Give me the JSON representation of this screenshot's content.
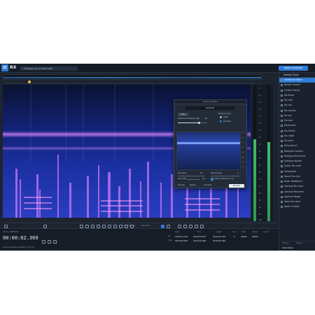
{
  "app": {
    "logo": "iZ",
    "name": "RX",
    "file_tab": "Dialogue on a beach.wav",
    "repair_assistant": "Repair Assistant",
    "time_display": "00:00:02.369",
    "instant_process": "Instant process",
    "attenuate": "Attenuate",
    "history_label": "Learned Ambience Match (175 ms)",
    "format": "24-bit | 48000 Hz",
    "zoom_label": "Zoom",
    "status_lines": [
      "Initial State"
    ]
  },
  "selection_info": {
    "start_label": "Start",
    "end_label": "End",
    "length_label": "Length",
    "low_label": "Low",
    "high_label": "High",
    "range_label": "Range",
    "cursor_label": "Cursor",
    "sel_label": "Sel",
    "view_label": "View",
    "sel_start": "00:00:01.760",
    "sel_end": "00:00:03.287",
    "sel_length": "00:00:01.526",
    "view_start": "00:00:00.000",
    "view_end": "00:00:02.286",
    "view_length": "00:00:02.286",
    "low": "0",
    "high": "24000",
    "range": "24000"
  },
  "module_panel": {
    "title": "Module Chain",
    "items": [
      "Ambience Match",
      "Breath Control",
      "Center Extract",
      "De-bleed",
      "De-click",
      "De-clip",
      "De-crackle",
      "De-ess",
      "De-hum",
      "De-plosive",
      "De-reverb",
      "De-rustle",
      "De-wind",
      "Deconstruct",
      "Dialogue Contour",
      "Dialogue De-reverb",
      "Dialogue Isolate",
      "Guitar De-noise",
      "Interpolate",
      "Mouth De-click",
      "Music Rebalance",
      "Spectral De-noise",
      "Spectral Recovery",
      "Spectral Repair",
      "Voice De-noise",
      "Wow & Flutter"
    ],
    "active_index": 0,
    "footer_tabs": [
      "Actions",
      "History"
    ],
    "footer_item": "Initial State"
  },
  "dialog": {
    "title": "Ambience Match",
    "preset": "[Default]",
    "learn": "Learn",
    "threshold_label": "Ambience threshold (dB)",
    "threshold_value": "-10",
    "ambience_type_label": "Ambience type",
    "type_options": [
      "Static",
      "Complex"
    ],
    "type_selected": 1,
    "movement_label": "Movement",
    "movement_value": "10",
    "randomness_label": "Randomness",
    "randomness_value": "0",
    "gain_label": "Gain (dB)",
    "gain_value": "0.0",
    "output_label": "Output ambience only",
    "preview": "Preview",
    "bypass": "Bypass",
    "compare": "Compare",
    "render": "Render",
    "scale": [
      "10k",
      "5k",
      "2k",
      "1k",
      "500",
      "200",
      "100",
      "50"
    ]
  },
  "db_scale": [
    "-5",
    "-10",
    "-15",
    "-20",
    "-25",
    "-30",
    "-35",
    "-40",
    "-45",
    "-50",
    "-55",
    "-60",
    "-65",
    "-70",
    "-75",
    "-80",
    "-85",
    "-90",
    "-95",
    "-100"
  ],
  "colors": {
    "accent": "#2f7cd6",
    "playhead": "#f2c230",
    "spectrogram_high": "#ff7dff",
    "spectrogram_low": "#0b1a5c"
  }
}
